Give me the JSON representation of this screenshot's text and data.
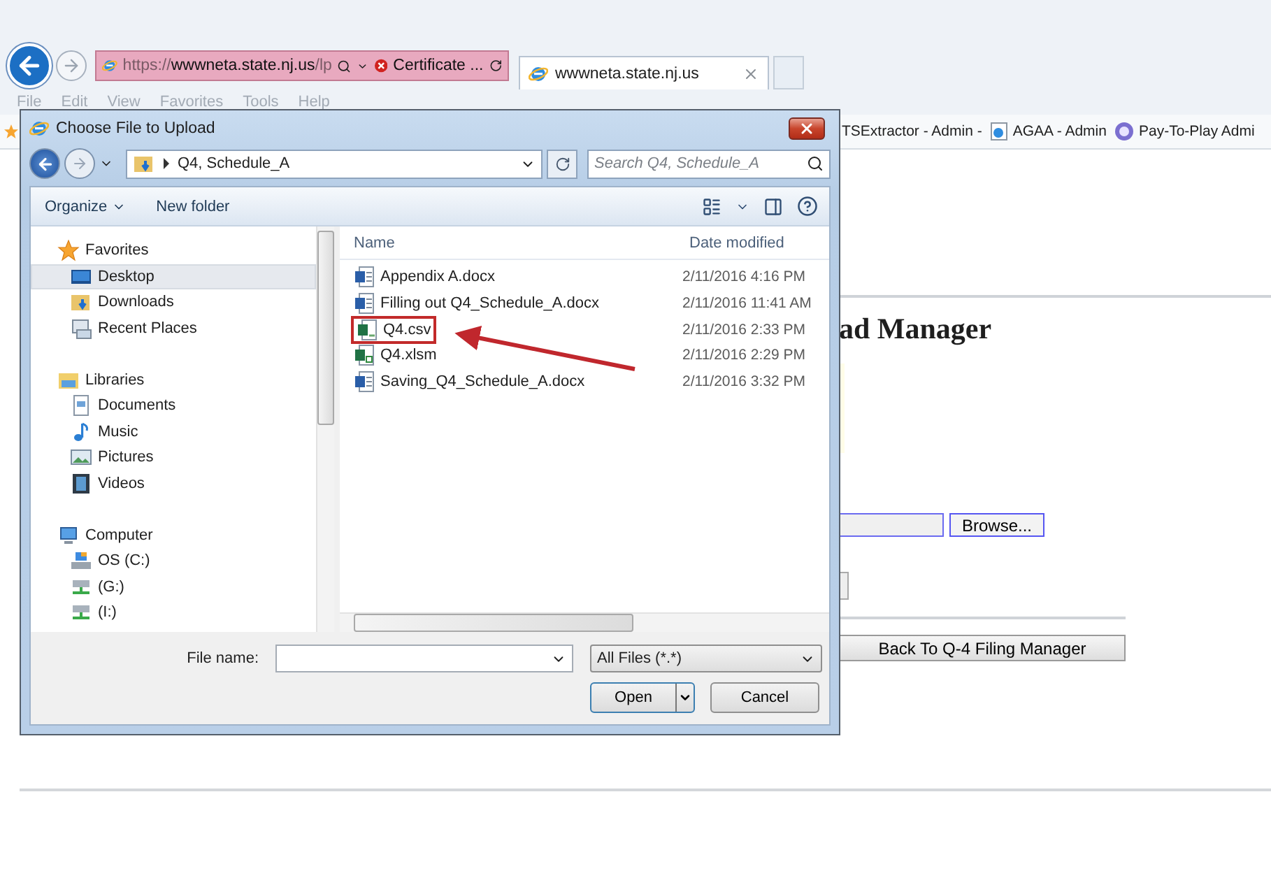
{
  "browser": {
    "address_bar": {
      "scheme": "https://",
      "host": "wwwneta.state.nj.us",
      "path": "/lp",
      "certificate_error": "Certificate ..."
    },
    "tabs": [
      {
        "title": "wwwneta.state.nj.us",
        "selected": true
      }
    ],
    "menu": [
      "File",
      "Edit",
      "View",
      "Favorites",
      "Tools",
      "Help"
    ],
    "favorites": [
      {
        "label": "TSExtractor - Admin -",
        "kind": "plain"
      },
      {
        "label": "AGAA - Admin",
        "kind": "page"
      },
      {
        "label": "Pay-To-Play Admi",
        "kind": "seal"
      }
    ]
  },
  "page": {
    "heading": "ad Manager",
    "browse_button": "Browse...",
    "back_button": "Back To Q-4 Filing Manager"
  },
  "dialog": {
    "title": "Choose File to Upload",
    "location": "Q4, Schedule_A",
    "search_placeholder": "Search Q4, Schedule_A",
    "toolbar": [
      {
        "label": "Organize",
        "kind": "menu"
      },
      {
        "label": "New folder",
        "kind": "button"
      }
    ],
    "navigation": [
      {
        "label": "Favorites",
        "kind": "favorites",
        "selected": false,
        "children": [
          {
            "label": "Desktop",
            "kind": "desktop",
            "selected": true
          },
          {
            "label": "Downloads",
            "kind": "downloads",
            "selected": false
          },
          {
            "label": "Recent Places",
            "kind": "recent",
            "selected": false
          }
        ]
      },
      {
        "label": "Libraries",
        "kind": "libraries",
        "selected": false,
        "children": [
          {
            "label": "Documents",
            "kind": "documents",
            "selected": false
          },
          {
            "label": "Music",
            "kind": "music",
            "selected": false
          },
          {
            "label": "Pictures",
            "kind": "pictures",
            "selected": false
          },
          {
            "label": "Videos",
            "kind": "videos",
            "selected": false
          }
        ]
      },
      {
        "label": "Computer",
        "kind": "computer",
        "selected": false,
        "children": [
          {
            "label": "OS (C:)",
            "kind": "drive",
            "selected": false
          },
          {
            "label": "(G:)",
            "kind": "network",
            "selected": false
          },
          {
            "label": "(I:)",
            "kind": "network",
            "selected": false
          }
        ]
      }
    ],
    "columns": [
      "Name",
      "Date modified"
    ],
    "files": [
      {
        "name": "Appendix A.docx",
        "modified": "2/11/2016 4:16 PM",
        "kind": "word",
        "highlighted": false
      },
      {
        "name": "Filling out Q4_Schedule_A.docx",
        "modified": "2/11/2016 11:41 AM",
        "kind": "word",
        "highlighted": false
      },
      {
        "name": "Q4.csv",
        "modified": "2/11/2016 2:33 PM",
        "kind": "csv",
        "highlighted": true
      },
      {
        "name": "Q4.xlsm",
        "modified": "2/11/2016 2:29 PM",
        "kind": "excel",
        "highlighted": false
      },
      {
        "name": "Saving_Q4_Schedule_A.docx",
        "modified": "2/11/2016 3:32 PM",
        "kind": "word",
        "highlighted": false
      }
    ],
    "file_name_label": "File name:",
    "file_type": "All Files (*.*)",
    "buttons": [
      {
        "label": "Open",
        "kind": "split"
      },
      {
        "label": "Cancel",
        "kind": "plain"
      }
    ]
  }
}
